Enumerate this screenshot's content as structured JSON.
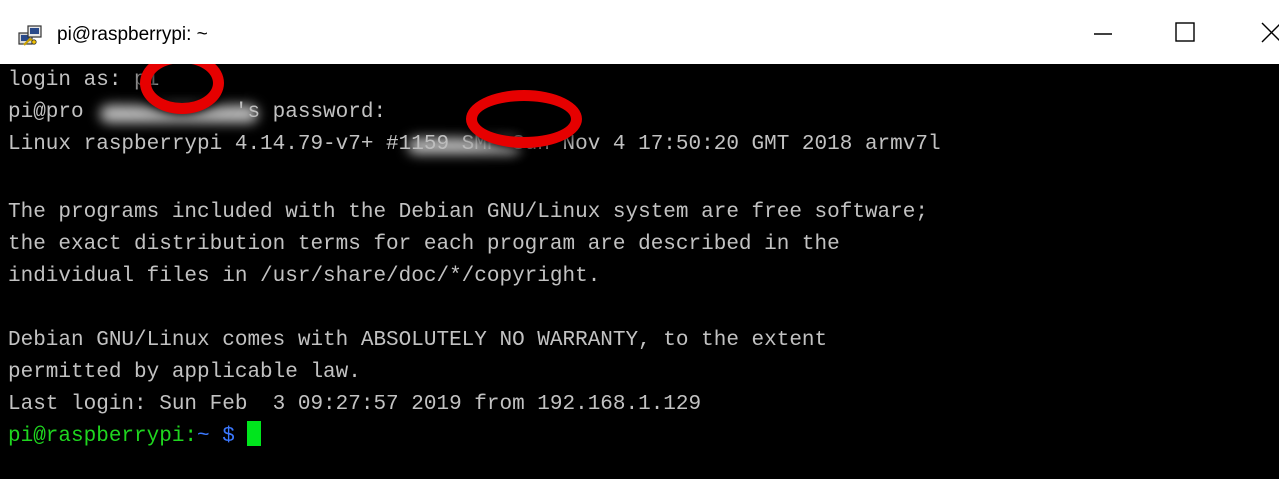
{
  "window": {
    "title": "pi@raspberrypi: ~",
    "icon": "putty-icon",
    "buttons": {
      "minimize": "—",
      "maximize": "☐",
      "close": "✕"
    }
  },
  "terminal": {
    "lines": [
      "login as: pi",
      "pi@pro            's password:",
      "Linux raspberrypi 4.14.79-v7+ #1159 SMP Sun Nov 4 17:50:20 GMT 2018 armv7l",
      "",
      "The programs included with the Debian GNU/Linux system are free software;",
      "the exact distribution terms for each program are described in the",
      "individual files in /usr/share/doc/*/copyright.",
      "",
      "Debian GNU/Linux comes with ABSOLUTELY NO WARRANTY, to the extent",
      "permitted by applicable law.",
      "Last login: Sun Feb  3 09:27:57 2019 from 192.168.1.129"
    ],
    "prompt": {
      "user_host": "pi@raspberrypi:",
      "path": "~ $"
    }
  },
  "colors": {
    "terminal_bg": "#000000",
    "terminal_fg": "#c2c2c2",
    "prompt_green": "#1fd61f",
    "prompt_blue": "#3b78ff",
    "cursor_green": "#00e51d",
    "annotation_red": "#e60000"
  }
}
